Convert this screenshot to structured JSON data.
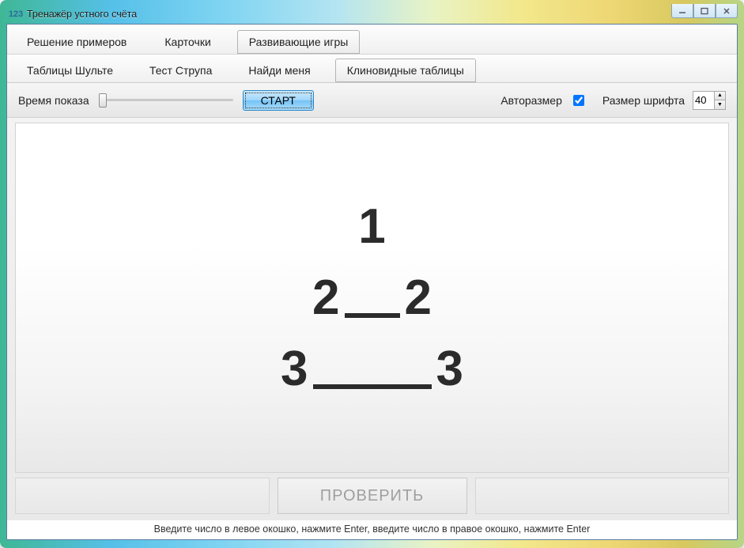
{
  "window": {
    "title": "Тренажёр устного счёта"
  },
  "tabs": {
    "main": [
      {
        "label": "Решение примеров",
        "active": false
      },
      {
        "label": "Карточки",
        "active": false
      },
      {
        "label": "Развивающие игры",
        "active": true
      }
    ],
    "sub": [
      {
        "label": "Таблицы Шульте",
        "active": false
      },
      {
        "label": "Тест Струпа",
        "active": false
      },
      {
        "label": "Найди меня",
        "active": false
      },
      {
        "label": "Клиновидные таблицы",
        "active": true
      }
    ]
  },
  "toolbar": {
    "show_time_label": "Время показа",
    "start_label": "СТАРТ",
    "autosize_label": "Авторазмер",
    "autosize_checked": true,
    "font_size_label": "Размер шрифта",
    "font_size_value": "40"
  },
  "wedge": {
    "rows": [
      {
        "left": "1",
        "right": ""
      },
      {
        "left": "2",
        "right": "2"
      },
      {
        "left": "3",
        "right": "3"
      }
    ]
  },
  "answer": {
    "check_label": "ПРОВЕРИТЬ"
  },
  "hint": "Введите число в левое окошко, нажмите Enter, введите число в правое окошко, нажмите Enter"
}
